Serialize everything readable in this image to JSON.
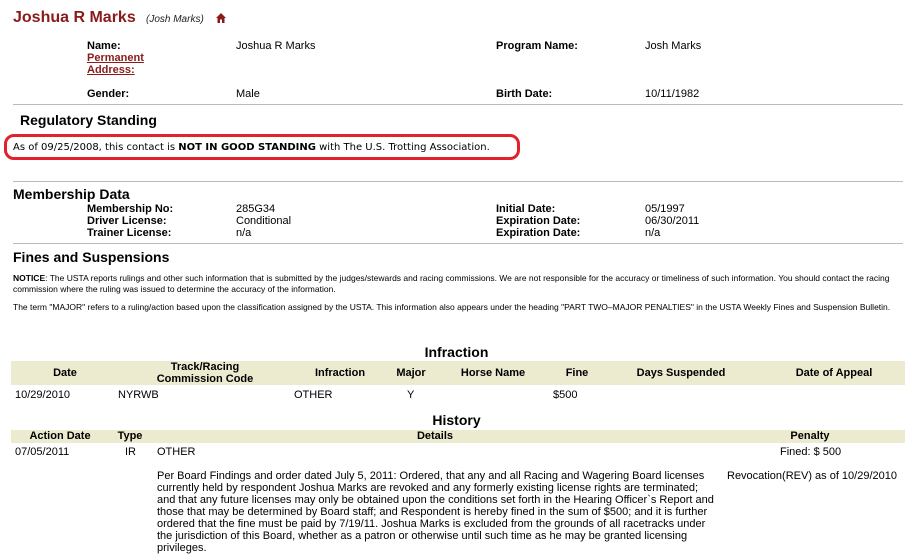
{
  "contact": {
    "full_name": "Joshua R Marks",
    "nickname": "(Josh Marks)",
    "home_icon": "home-icon"
  },
  "profile": {
    "name_label": "Name:",
    "name_value": "Joshua R Marks",
    "permanent_address_link": "Permanent",
    "permanent_address_link2": "Address:",
    "program_name_label": "Program Name:",
    "program_name_value": "Josh Marks",
    "gender_label": "Gender:",
    "gender_value": "Male",
    "birth_date_label": "Birth Date:",
    "birth_date_value": "10/11/1982"
  },
  "regulatory": {
    "heading": "Regulatory Standing",
    "prefix": "As of 09/25/2008, this contact is ",
    "status": "NOT IN GOOD STANDING",
    "suffix": " with The U.S. Trotting Association.",
    "highlight_color": "#e3202b"
  },
  "membership": {
    "heading": "Membership Data",
    "membership_no_label": "Membership No:",
    "membership_no_value": "285G34",
    "initial_date_label": "Initial Date:",
    "initial_date_value": "05/1997",
    "driver_license_label": "Driver License:",
    "driver_license_value": "Conditional",
    "driver_exp_label": "Expiration Date:",
    "driver_exp_value": "06/30/2011",
    "trainer_license_label": "Trainer License:",
    "trainer_license_value": "n/a",
    "trainer_exp_label": "Expiration Date:",
    "trainer_exp_value": "n/a"
  },
  "fines": {
    "heading": "Fines and Suspensions",
    "notice_label": "NOTICE",
    "notice_text": ": The USTA reports rulings and other such information that is submitted by the judges/stewards and racing commissions. We are not responsible for the accuracy or timeliness of such information. You should contact the racing commission where the ruling was issued to determine the accuracy of the information.",
    "major_text": "The term \"MAJOR\" refers to a ruling/action based upon the classification assigned by the USTA. This information also appears under the heading \"PART TWO–MAJOR PENALTIES\" in the USTA Weekly Fines and Suspension Bulletin."
  },
  "infraction": {
    "heading": "Infraction",
    "columns": {
      "date": "Date",
      "track1": "Track/Racing",
      "track2": "Commission Code",
      "infraction": "Infraction",
      "major": "Major",
      "horse": "Horse Name",
      "fine": "Fine",
      "days": "Days Suspended",
      "appeal": "Date of Appeal"
    },
    "row": {
      "date": "10/29/2010",
      "track": "NYRWB",
      "infraction": "OTHER",
      "major": "Y",
      "horse": "",
      "fine": "$500",
      "days": "",
      "appeal": ""
    }
  },
  "history": {
    "heading": "History",
    "columns": {
      "action_date": "Action Date",
      "type": "Type",
      "details": "Details",
      "penalty": "Penalty"
    },
    "row": {
      "action_date": "07/05/2011",
      "type": "IR",
      "category": "OTHER",
      "details": "Per Board Findings and order dated July 5, 2011: Ordered, that any and all Racing and Wagering Board licenses currently held by respondent Joshua Marks are revoked and any formerly existing license rights are terminated; and that any future licenses may only be obtained upon the conditions set forth in the Hearing Officer`s Report and those that may be determined by Board staff; and Respondent is hereby fined in the sum of $500; and it is further ordered that the fine must be paid by 7/19/11. Joshua Marks is excluded from the grounds of all racetracks under the jurisdiction of this Board, whether as a patron or otherwise until such time as he may be granted licensing privileges.",
      "penalty_fine": "Fined: $ 500",
      "penalty_revocation": "Revocation(REV) as of 10/29/2010"
    }
  },
  "colors": {
    "title": "#8b1a1a",
    "table_header_bg": "#ecebd0"
  }
}
